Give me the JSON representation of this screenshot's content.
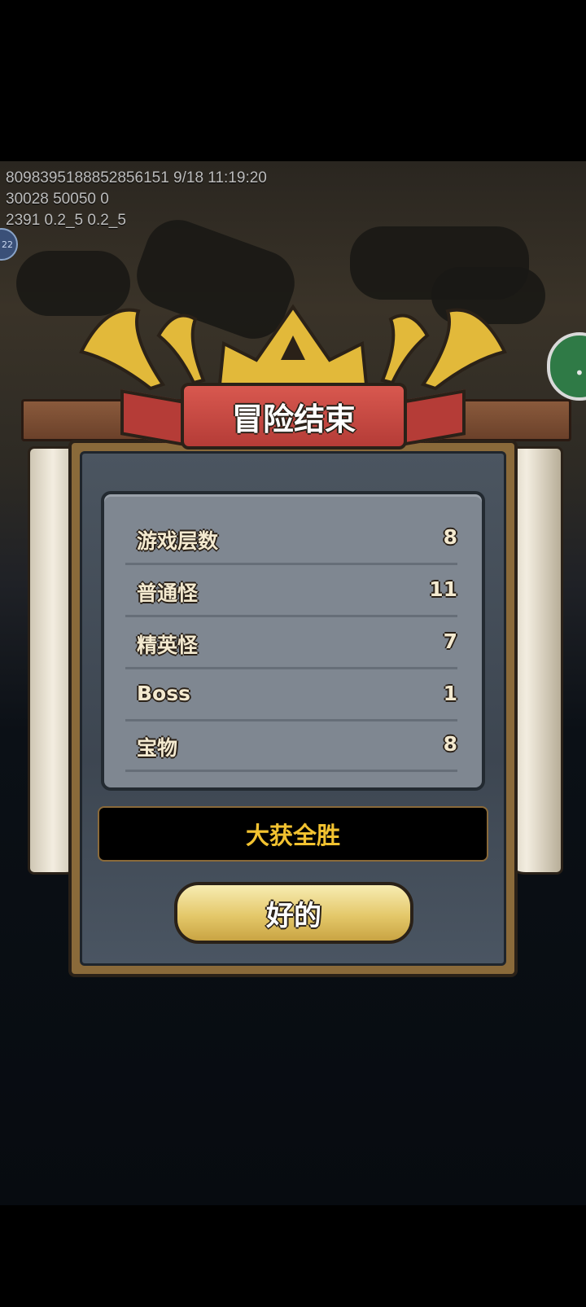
{
  "debug": {
    "line1": "809839518885285615​1 9/18 11:19:20",
    "line2": "30028 50050 0",
    "line3": "2391 0.2_5 0.2_5"
  },
  "avatar_badge": "22",
  "dialog": {
    "title": "冒险结束",
    "stats": [
      {
        "label": "游戏层数",
        "value": "8"
      },
      {
        "label": "普通怪",
        "value": "11"
      },
      {
        "label": "精英怪",
        "value": "7"
      },
      {
        "label": "Boss",
        "value": "1"
      },
      {
        "label": "宝物",
        "value": "8"
      }
    ],
    "result": "大获全胜",
    "ok_button": "好的"
  },
  "colors": {
    "banner": "#c84a44",
    "result_text": "#f2c230",
    "button_gold": "#e4c86a"
  }
}
